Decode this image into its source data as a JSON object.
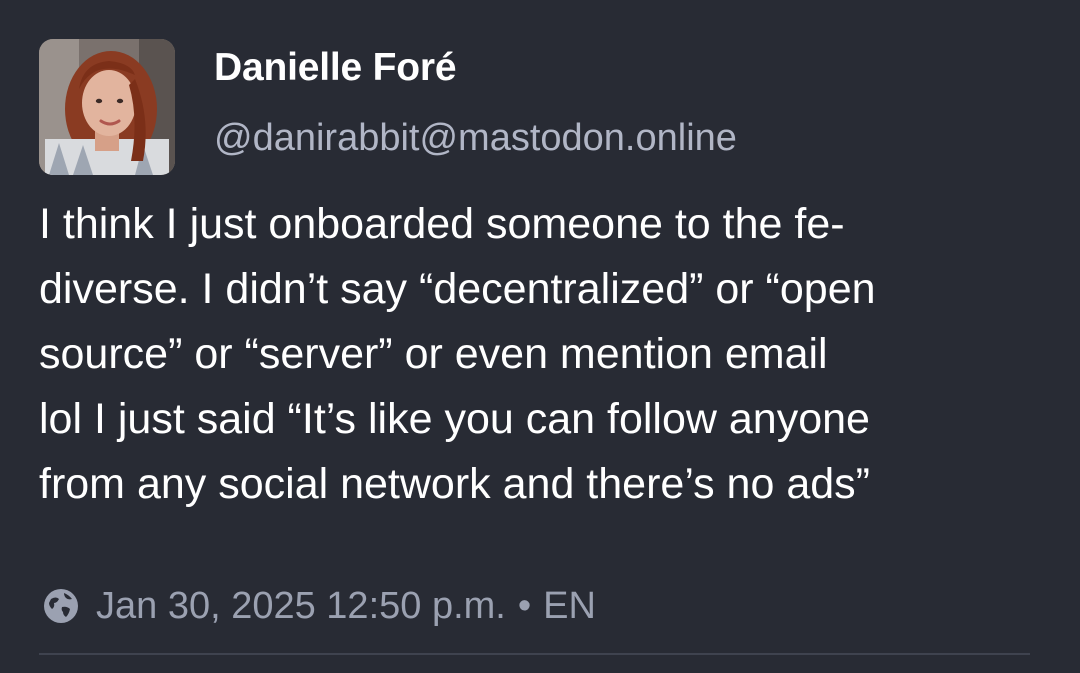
{
  "author": {
    "display_name": "Danielle Foré",
    "handle": "@danirabbit@mastodon.online",
    "avatar_icon": "user-avatar-photo"
  },
  "post": {
    "lines": [
      "I think I just onboarded someone to the fe-",
      "diverse. I didn’t say “decentralized” or “open",
      "source” or “server” or even mention email",
      "lol I just said “It’s like you can follow anyone",
      "from any social network and there’s no ads”"
    ]
  },
  "meta": {
    "visibility_icon": "globe-icon",
    "timestamp": "Jan 30, 2025 12:50 p.m.",
    "separator": "•",
    "language": "EN"
  },
  "colors": {
    "background": "#282b34",
    "text": "#ffffff",
    "muted": "#9ba1b1",
    "handle": "#b1b6c6"
  }
}
